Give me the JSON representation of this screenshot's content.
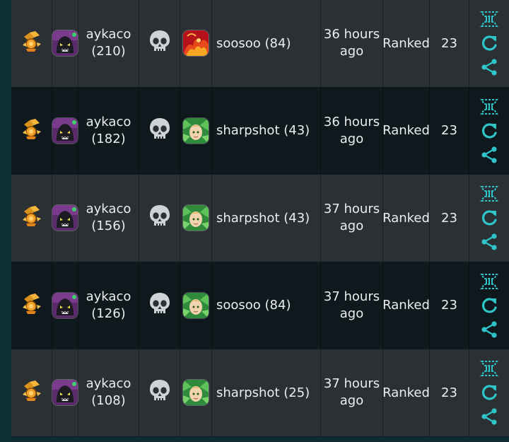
{
  "colors": {
    "accent": "#2ec4c8",
    "row_dark": "#0f181d",
    "row_light": "#2b3034"
  },
  "icons": {
    "trophy": "winner-trophy-icon",
    "skull": "skull-icon",
    "replay": "replay-icon",
    "repeat": "rematch-icon",
    "share": "share-icon"
  },
  "rows": [
    {
      "player1": "aykaco",
      "player1_score": "(210)",
      "player2": "soosoo (84)",
      "time_line1": "36 hours",
      "time_line2": "ago",
      "mode": "Ranked",
      "number": "23"
    },
    {
      "player1": "aykaco",
      "player1_score": "(182)",
      "player2": "sharpshot (43)",
      "time_line1": "36 hours",
      "time_line2": "ago",
      "mode": "Ranked",
      "number": "23"
    },
    {
      "player1": "aykaco",
      "player1_score": "(156)",
      "player2": "sharpshot (43)",
      "time_line1": "37 hours",
      "time_line2": "ago",
      "mode": "Ranked",
      "number": "23"
    },
    {
      "player1": "aykaco",
      "player1_score": "(126)",
      "player2": "soosoo (84)",
      "time_line1": "37 hours",
      "time_line2": "ago",
      "mode": "Ranked",
      "number": "23"
    },
    {
      "player1": "aykaco",
      "player1_score": "(108)",
      "player2": "sharpshot (25)",
      "time_line1": "37 hours",
      "time_line2": "ago",
      "mode": "Ranked",
      "number": "23"
    }
  ]
}
